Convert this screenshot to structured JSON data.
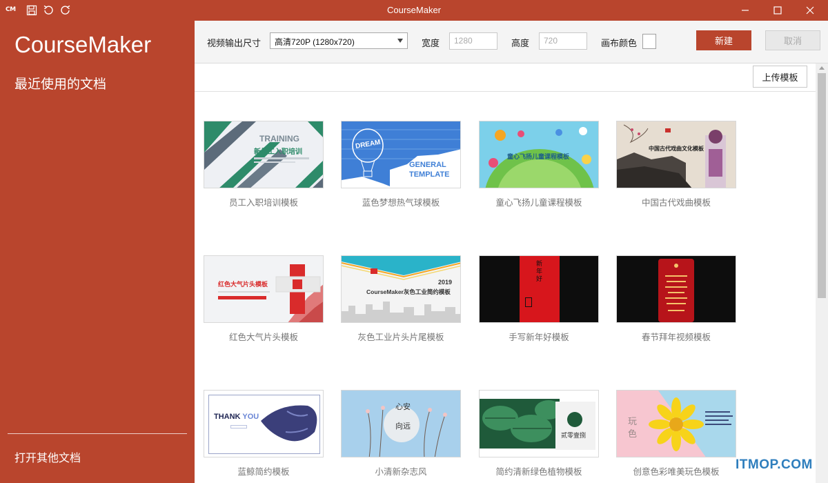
{
  "window": {
    "title": "CourseMaker",
    "logo_text": "CM"
  },
  "sidebar": {
    "app_name": "CourseMaker",
    "recent_docs_label": "最近使用的文档",
    "open_other_label": "打开其他文档"
  },
  "toolbar": {
    "output_size_label": "视频输出尺寸",
    "output_size_value": "高清720P (1280x720)",
    "width_label": "宽度",
    "width_placeholder": "1280",
    "height_label": "高度",
    "height_placeholder": "720",
    "canvas_color_label": "画布颜色",
    "new_label": "新建",
    "cancel_label": "取消"
  },
  "content": {
    "upload_label": "上传模板"
  },
  "templates": [
    {
      "name": "员工入职培训模板",
      "thumb_text": [
        "TRAINING",
        "新员工入职培训"
      ]
    },
    {
      "name": "蓝色梦想热气球模板",
      "thumb_text": [
        "DREAM",
        "GENERAL",
        "TEMPLATE"
      ]
    },
    {
      "name": "童心飞扬儿童课程模板",
      "thumb_text": [
        "童心飞扬儿童课程模板"
      ]
    },
    {
      "name": "中国古代戏曲模板",
      "thumb_text": [
        "中国古代戏曲文化模板"
      ]
    },
    {
      "name": "红色大气片头模板",
      "thumb_text": [
        "红色大气片头模板"
      ]
    },
    {
      "name": "灰色工业片头片尾模板",
      "thumb_text": [
        "2019",
        "CourseMaker灰色工业简约模板"
      ]
    },
    {
      "name": "手写新年好模板",
      "thumb_text": [
        "新年好"
      ]
    },
    {
      "name": "春节拜年视频模板",
      "thumb_text": []
    },
    {
      "name": "蓝鲸简约模板",
      "thumb_text": [
        "THANK",
        "YOU"
      ]
    },
    {
      "name": "小清新杂志风",
      "thumb_text": [
        "心安",
        "向远"
      ]
    },
    {
      "name": "简约清新绿色植物模板",
      "thumb_text": [
        "贰零壹捌"
      ]
    },
    {
      "name": "创意色彩唯美玩色模板",
      "thumb_text": [
        "玩",
        "色"
      ]
    }
  ],
  "watermark": "ITMOP.COM",
  "colors": {
    "accent": "#b9452d",
    "toolbar_bg": "#f4f4f4"
  }
}
